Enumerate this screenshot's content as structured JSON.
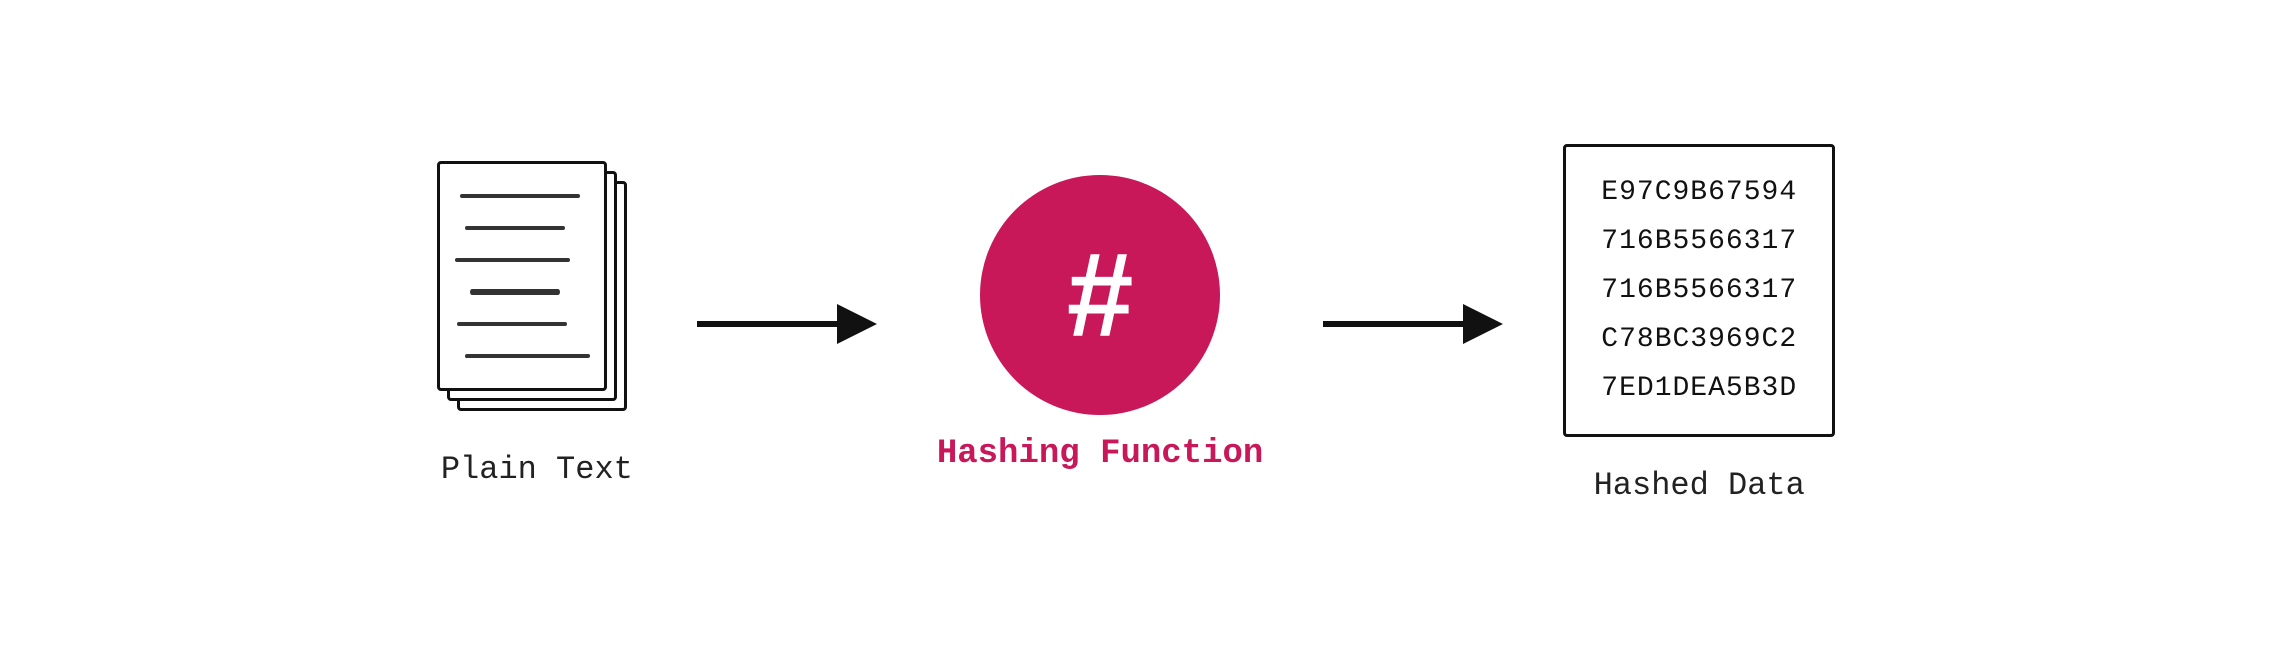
{
  "diagram": {
    "plain_text_label": "Plain Text",
    "hashing_function_label": "Hashing Function",
    "hashed_data_label": "Hashed Data",
    "hash_symbol": "#",
    "hash_values": [
      "E97C9B67594",
      "716B5566317",
      "716B5566317",
      "C78BC3969C2",
      "7ED1DEA5B3D"
    ],
    "arrow_color": "#111111",
    "circle_color": "#c8185a",
    "hash_label_color": "#c8185a"
  }
}
